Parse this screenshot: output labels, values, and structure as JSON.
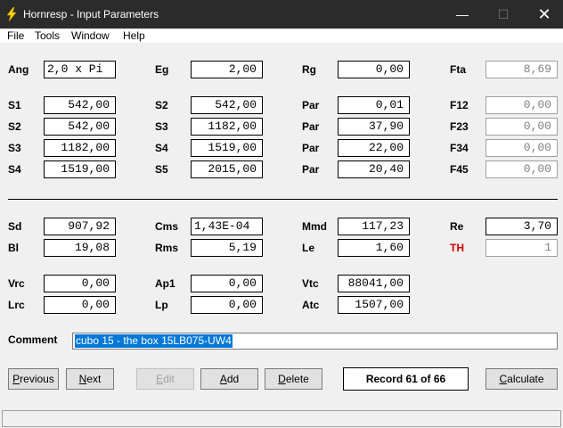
{
  "window": {
    "title": "Hornresp - Input Parameters",
    "minimize_glyph": "—",
    "maximize_glyph": "☐",
    "close_glyph": "✕",
    "app_icon": "lightning-icon",
    "accent": "#ffd700"
  },
  "menu": {
    "file": "File",
    "tools": "Tools",
    "window": "Window",
    "help": "Help"
  },
  "params": {
    "ang": {
      "label": "Ang",
      "value": "2,0 x Pi"
    },
    "eg": {
      "label": "Eg",
      "value": "2,00"
    },
    "rg": {
      "label": "Rg",
      "value": "0,00"
    },
    "fta": {
      "label": "Fta",
      "value": "8,69"
    },
    "s1": {
      "label": "S1",
      "value": "542,00"
    },
    "s2a": {
      "label": "S2",
      "value": "542,00"
    },
    "s2b": {
      "label": "S2",
      "value": "542,00"
    },
    "s3a": {
      "label": "S3",
      "value": "1182,00"
    },
    "s3b": {
      "label": "S3",
      "value": "1182,00"
    },
    "s4a": {
      "label": "S4",
      "value": "1519,00"
    },
    "s4b": {
      "label": "S4",
      "value": "1519,00"
    },
    "s5": {
      "label": "S5",
      "value": "2015,00"
    },
    "par1": {
      "label": "Par",
      "value": "0,01"
    },
    "par2": {
      "label": "Par",
      "value": "37,90"
    },
    "par3": {
      "label": "Par",
      "value": "22,00"
    },
    "par4": {
      "label": "Par",
      "value": "20,40"
    },
    "f12": {
      "label": "F12",
      "value": "0,00"
    },
    "f23": {
      "label": "F23",
      "value": "0,00"
    },
    "f34": {
      "label": "F34",
      "value": "0,00"
    },
    "f45": {
      "label": "F45",
      "value": "0,00"
    },
    "sd": {
      "label": "Sd",
      "value": "907,92"
    },
    "cms": {
      "label": "Cms",
      "value": "1,43E-04"
    },
    "mmd": {
      "label": "Mmd",
      "value": "117,23"
    },
    "re": {
      "label": "Re",
      "value": "3,70"
    },
    "bl": {
      "label": "Bl",
      "value": "19,08"
    },
    "rms": {
      "label": "Rms",
      "value": "5,19"
    },
    "le": {
      "label": "Le",
      "value": "1,60"
    },
    "th": {
      "label": "TH",
      "value": "1"
    },
    "vrc": {
      "label": "Vrc",
      "value": "0,00"
    },
    "ap1": {
      "label": "Ap1",
      "value": "0,00"
    },
    "vtc": {
      "label": "Vtc",
      "value": "88041,00"
    },
    "lrc": {
      "label": "Lrc",
      "value": "0,00"
    },
    "lp": {
      "label": "Lp",
      "value": "0,00"
    },
    "atc": {
      "label": "Atc",
      "value": "1507,00"
    }
  },
  "comment": {
    "label": "Comment",
    "value": "cubo 15 - the box 15LB075-UW4"
  },
  "buttons": {
    "previous": {
      "first": "P",
      "rest": "revious"
    },
    "next": {
      "first": "N",
      "rest": "ext"
    },
    "edit": {
      "first": "E",
      "rest": "dit"
    },
    "add": {
      "first": "A",
      "rest": "dd"
    },
    "delete": {
      "first": "D",
      "rest": "elete"
    },
    "calculate": {
      "first": "C",
      "rest": "alculate"
    }
  },
  "record": "Record 61 of 66"
}
